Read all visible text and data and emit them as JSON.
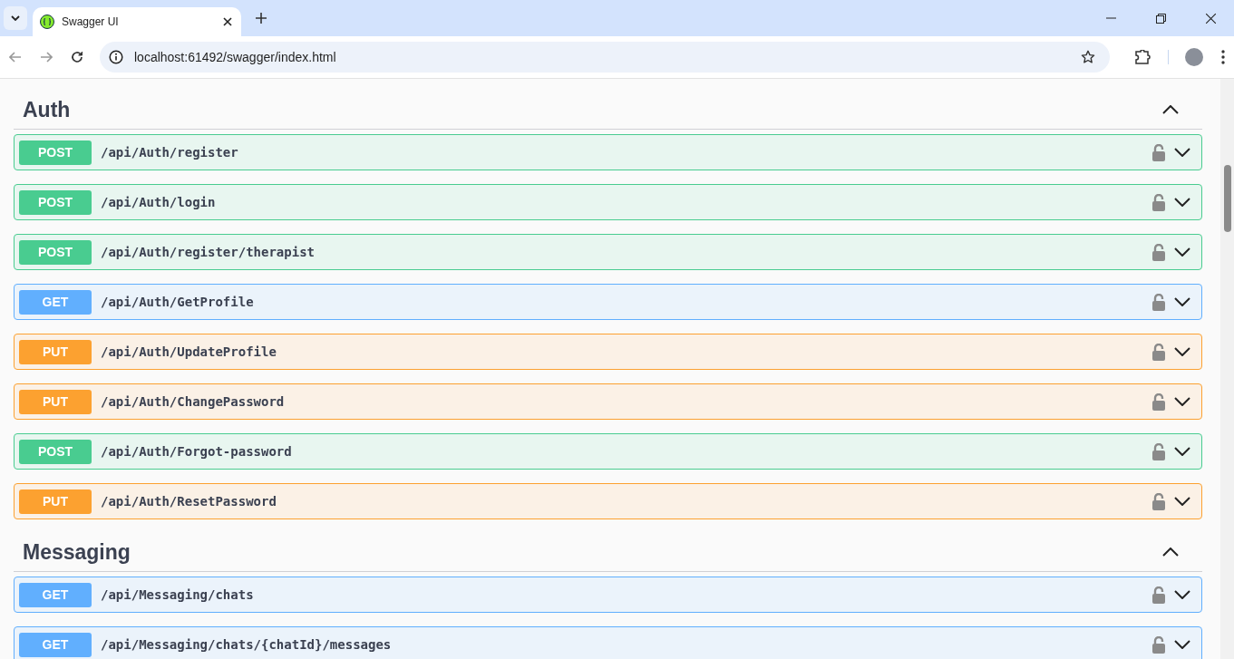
{
  "browser": {
    "tab": {
      "title": "Swagger UI",
      "selected": true
    },
    "address": "localhost:61492/swagger/index.html"
  },
  "sections": [
    {
      "title": "Auth",
      "expanded": true,
      "operations": [
        {
          "kind": "post",
          "method": "POST",
          "path": "/api/Auth/register"
        },
        {
          "kind": "post",
          "method": "POST",
          "path": "/api/Auth/login"
        },
        {
          "kind": "post",
          "method": "POST",
          "path": "/api/Auth/register/therapist"
        },
        {
          "kind": "get",
          "method": "GET",
          "path": "/api/Auth/GetProfile"
        },
        {
          "kind": "put",
          "method": "PUT",
          "path": "/api/Auth/UpdateProfile"
        },
        {
          "kind": "put",
          "method": "PUT",
          "path": "/api/Auth/ChangePassword"
        },
        {
          "kind": "post",
          "method": "POST",
          "path": "/api/Auth/Forgot-password"
        },
        {
          "kind": "put",
          "method": "PUT",
          "path": "/api/Auth/ResetPassword"
        }
      ]
    },
    {
      "title": "Messaging",
      "expanded": true,
      "operations": [
        {
          "kind": "get",
          "method": "GET",
          "path": "/api/Messaging/chats"
        },
        {
          "kind": "get",
          "method": "GET",
          "path": "/api/Messaging/chats/{chatId}/messages"
        }
      ]
    }
  ]
}
